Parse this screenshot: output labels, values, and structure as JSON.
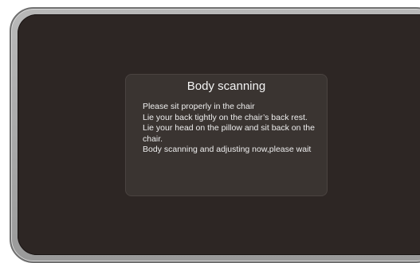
{
  "dialog": {
    "title": "Body scanning",
    "lines": [
      "Please sit properly in the chair",
      "Lie your back tightly on the chair’s back rest.",
      "Lie your head on the pillow and sit back on the chair.",
      "Body scanning and adjusting now,please wait"
    ]
  },
  "colors": {
    "screen_background": "#2d2624",
    "dialog_background": "#3a3431",
    "frame": "#a8a8a8",
    "text": "#f2f2f2"
  }
}
